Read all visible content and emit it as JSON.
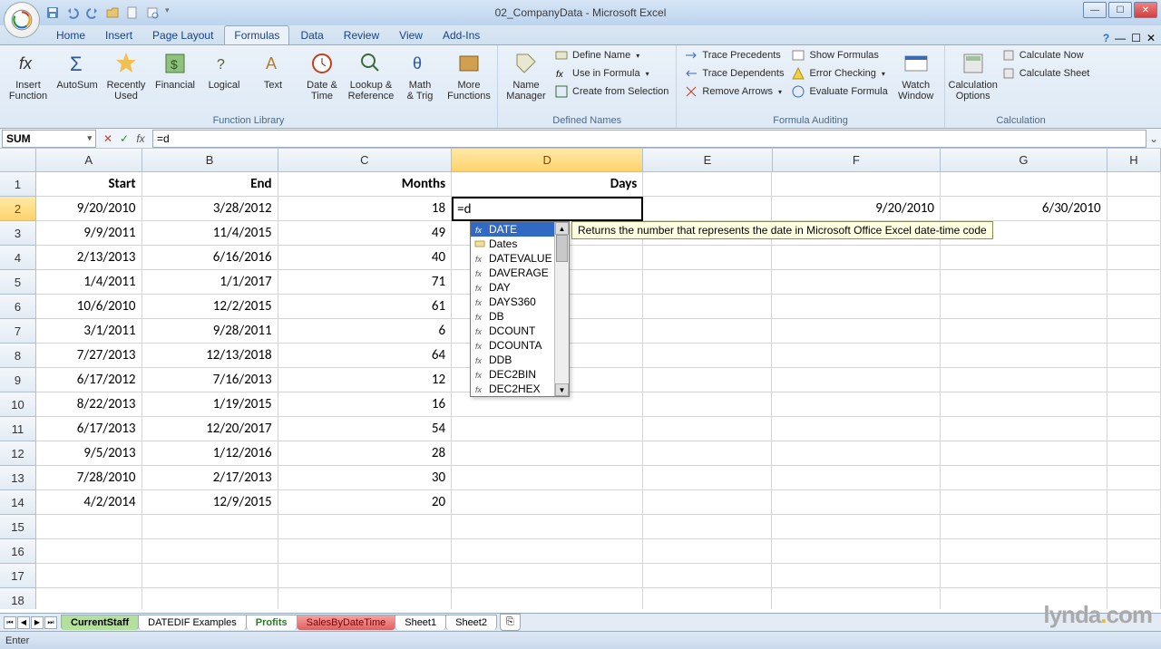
{
  "app": {
    "title": "02_CompanyData - Microsoft Excel"
  },
  "tabs": {
    "items": [
      "Home",
      "Insert",
      "Page Layout",
      "Formulas",
      "Data",
      "Review",
      "View",
      "Add-Ins"
    ],
    "active_index": 3
  },
  "ribbon": {
    "groups": {
      "function_library": {
        "label": "Function Library",
        "insert_function": "Insert\nFunction",
        "autosum": "AutoSum",
        "recently_used": "Recently\nUsed",
        "financial": "Financial",
        "logical": "Logical",
        "text": "Text",
        "date_time": "Date &\nTime",
        "lookup_ref": "Lookup &\nReference",
        "math_trig": "Math\n& Trig",
        "more_functions": "More\nFunctions"
      },
      "defined_names": {
        "label": "Defined Names",
        "name_manager": "Name\nManager",
        "define_name": "Define Name",
        "use_in_formula": "Use in Formula",
        "create_from_selection": "Create from Selection"
      },
      "formula_auditing": {
        "label": "Formula Auditing",
        "trace_precedents": "Trace Precedents",
        "trace_dependents": "Trace Dependents",
        "remove_arrows": "Remove Arrows",
        "show_formulas": "Show Formulas",
        "error_checking": "Error Checking",
        "evaluate_formula": "Evaluate Formula",
        "watch_window": "Watch\nWindow"
      },
      "calculation": {
        "label": "Calculation",
        "calculation_options": "Calculation\nOptions",
        "calculate_now": "Calculate Now",
        "calculate_sheet": "Calculate Sheet"
      }
    }
  },
  "formula_bar": {
    "name_box": "SUM",
    "formula": "=d"
  },
  "columns": [
    "A",
    "B",
    "C",
    "D",
    "E",
    "F",
    "G",
    "H"
  ],
  "active_col_index": 3,
  "active_row_index": 1,
  "headers": [
    "Start",
    "End",
    "Months",
    "Days",
    "",
    "",
    "",
    ""
  ],
  "rows": [
    [
      "9/20/2010",
      "3/28/2012",
      "18",
      "=d",
      "",
      "9/20/2010",
      "6/30/2010",
      ""
    ],
    [
      "9/9/2011",
      "11/4/2015",
      "49",
      "",
      "",
      "",
      "",
      ""
    ],
    [
      "2/13/2013",
      "6/16/2016",
      "40",
      "",
      "",
      "",
      "",
      ""
    ],
    [
      "1/4/2011",
      "1/1/2017",
      "71",
      "",
      "",
      "",
      "",
      ""
    ],
    [
      "10/6/2010",
      "12/2/2015",
      "61",
      "",
      "",
      "",
      "",
      ""
    ],
    [
      "3/1/2011",
      "9/28/2011",
      "6",
      "",
      "",
      "",
      "",
      ""
    ],
    [
      "7/27/2013",
      "12/13/2018",
      "64",
      "",
      "",
      "",
      "",
      ""
    ],
    [
      "6/17/2012",
      "7/16/2013",
      "12",
      "",
      "",
      "",
      "",
      ""
    ],
    [
      "8/22/2013",
      "1/19/2015",
      "16",
      "",
      "",
      "",
      "",
      ""
    ],
    [
      "6/17/2013",
      "12/20/2017",
      "54",
      "",
      "",
      "",
      "",
      ""
    ],
    [
      "9/5/2013",
      "1/12/2016",
      "28",
      "",
      "",
      "",
      "",
      ""
    ],
    [
      "7/28/2010",
      "2/17/2013",
      "30",
      "",
      "",
      "",
      "",
      ""
    ],
    [
      "4/2/2014",
      "12/9/2015",
      "20",
      "",
      "",
      "",
      "",
      ""
    ]
  ],
  "autocomplete": {
    "items": [
      "DATE",
      "Dates",
      "DATEVALUE",
      "DAVERAGE",
      "DAY",
      "DAYS360",
      "DB",
      "DCOUNT",
      "DCOUNTA",
      "DDB",
      "DEC2BIN",
      "DEC2HEX"
    ],
    "selected_index": 0,
    "tooltip": "Returns the number that represents the date in Microsoft Office Excel date-time code"
  },
  "sheet_tabs": [
    "CurrentStaff",
    "DATEDIF Examples",
    "Profits",
    "SalesByDateTime",
    "Sheet1",
    "Sheet2"
  ],
  "status": {
    "mode": "Enter"
  },
  "watermark": {
    "text": "lynda.com"
  }
}
